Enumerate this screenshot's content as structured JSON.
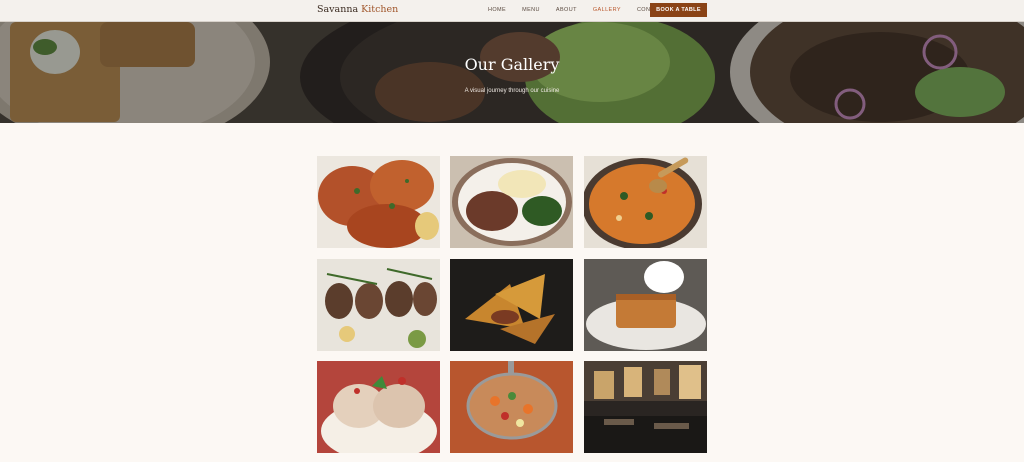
{
  "nav": {
    "brand_first": "Savanna",
    "brand_second": "Kitchen",
    "links": [
      "HOME",
      "MENU",
      "ABOUT",
      "GALLERY",
      "CONTACT"
    ],
    "active": "GALLERY",
    "cta": "BOOK A TABLE"
  },
  "hero": {
    "title": "Our Gallery",
    "subtitle": "A visual journey through our cuisine"
  },
  "gallery": {
    "images": [
      {
        "name": "grilled-chicken-photo"
      },
      {
        "name": "shredded-beef-mash-greens-photo"
      },
      {
        "name": "curry-stew-pot-photo"
      },
      {
        "name": "lamb-chops-herbs-photo"
      },
      {
        "name": "fried-turnovers-photo"
      },
      {
        "name": "cake-with-cream-photo"
      },
      {
        "name": "ice-cream-mint-photo"
      },
      {
        "name": "vegetable-soup-ladle-photo"
      },
      {
        "name": "restaurant-interior-photo"
      }
    ]
  },
  "colors": {
    "accent": "#8a4316",
    "active_link": "#b9562a",
    "background": "#fcf8f4"
  }
}
